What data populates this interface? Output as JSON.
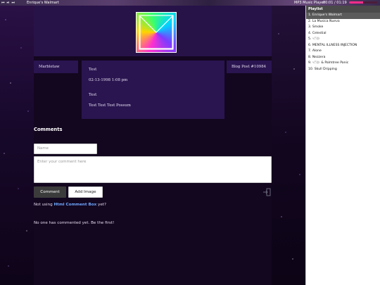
{
  "music_player": {
    "controls": [
      "⏮",
      "⏯",
      "⏭"
    ],
    "track_title": "Enrique's Walmart",
    "player_label": "MP3 Music Player",
    "time": "00:01 / 01:19",
    "progress_fraction": 0.5,
    "accent_color": "#ff2d8a"
  },
  "playlist": {
    "title": "Playlist",
    "items": [
      "1. Enrique's Walmart",
      "2. La Musica Nueva",
      "3. Smoke",
      "4. Celestial",
      "5. ᛃᚩᚱᚦ",
      "6. MENTAL ILLNESS INJECTION",
      "7. Alone",
      "8. Nezzera",
      "9. ᛃᚩᚱᚦ & Palmtree Panic",
      "10. Skull Dripping"
    ],
    "active_index": 0
  },
  "post": {
    "username": "Marbletaw",
    "title": "Test",
    "date": "02-13-1998 1:08 pm",
    "subtitle": "Test",
    "body": "Test Test Test Possum",
    "blog_post_label": "Blog Post #10984"
  },
  "comments": {
    "heading": "Comments",
    "name_placeholder": "Name",
    "comment_placeholder": "Enter your comment here",
    "comment_button": "Comment",
    "add_image_button": "Add Image",
    "not_using_prefix": "Not using",
    "not_using_link": "Html Comment Box",
    "not_using_suffix": "yet?",
    "empty_message": "No one has commented yet. Be the first!"
  },
  "colors": {
    "background": "#12051e",
    "panel": "#2a1550",
    "banner": "#271348",
    "link": "#6fa8ff"
  },
  "icons": {
    "logo": "m-logo-icon",
    "login": "login-icon"
  }
}
